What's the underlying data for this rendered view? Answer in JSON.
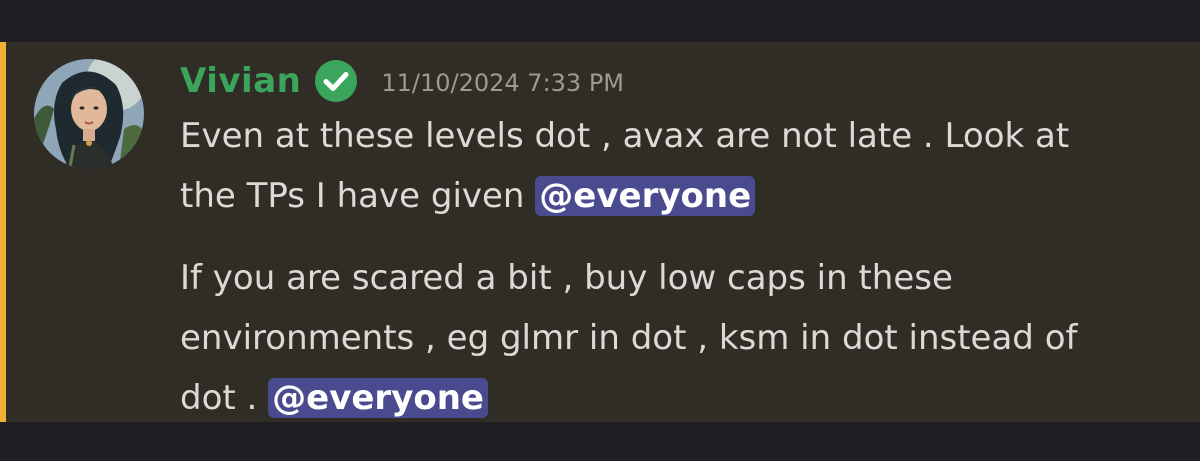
{
  "message": {
    "author": "Vivian",
    "timestamp": "11/10/2024 7:33 PM",
    "paragraph1": {
      "line1": "Even at these levels dot , avax are not late . Look at",
      "line2_text": "the TPs I have given ",
      "line2_mention": "@everyone"
    },
    "paragraph2": {
      "line1": "If you are scared a bit , buy low caps in these",
      "line2": "environments , eg glmr in dot , ksm in dot instead of",
      "line3_text": "dot . ",
      "line3_mention": "@everyone"
    }
  },
  "colors": {
    "username": "#3ba55c",
    "mention_bg": "#4a4b8e",
    "highlight_bar": "#f0b232",
    "message_bg": "#302d26",
    "app_bg": "#1e1f22"
  },
  "icons": {
    "verified": "check-circle-icon",
    "avatar": "user-avatar-illustration"
  }
}
